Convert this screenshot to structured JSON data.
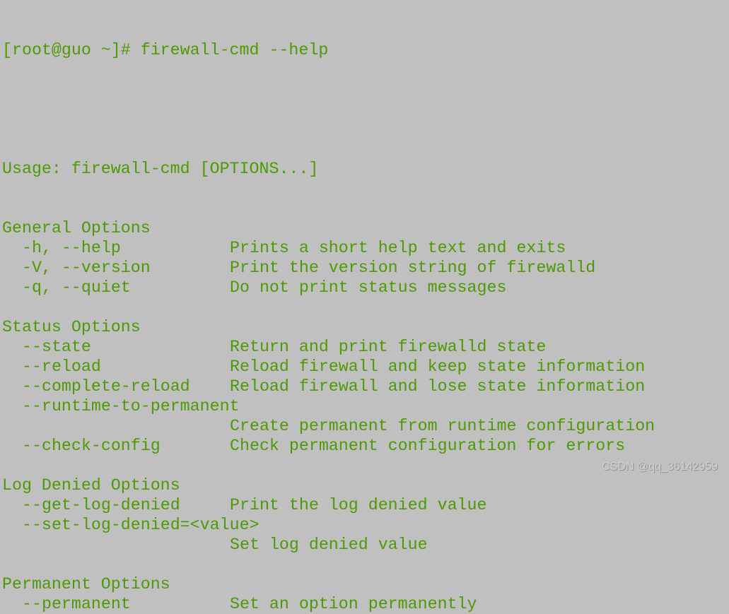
{
  "prompt": "[root@guo ~]# firewall-cmd --help",
  "usage": "Usage: firewall-cmd [OPTIONS...]",
  "sections": [
    {
      "title": "General Options",
      "options": [
        {
          "flag": "-h, --help",
          "desc": "Prints a short help text and exits"
        },
        {
          "flag": "-V, --version",
          "desc": "Print the version string of firewalld"
        },
        {
          "flag": "-q, --quiet",
          "desc": "Do not print status messages"
        }
      ]
    },
    {
      "title": "Status Options",
      "options": [
        {
          "flag": "--state",
          "desc": "Return and print firewalld state"
        },
        {
          "flag": "--reload",
          "desc": "Reload firewall and keep state information"
        },
        {
          "flag": "--complete-reload",
          "desc": "Reload firewall and lose state information"
        },
        {
          "flag": "--runtime-to-permanent",
          "desc": "Create permanent from runtime configuration",
          "wrap": true
        },
        {
          "flag": "--check-config",
          "desc": "Check permanent configuration for errors"
        }
      ]
    },
    {
      "title": "Log Denied Options",
      "options": [
        {
          "flag": "--get-log-denied",
          "desc": "Print the log denied value"
        },
        {
          "flag": "--set-log-denied=<value>",
          "desc": "Set log denied value",
          "wrap": true
        }
      ]
    },
    {
      "title": "Permanent Options",
      "options": [
        {
          "flag": "--permanent",
          "desc": "Set an option permanently"
        }
      ]
    }
  ],
  "watermark": "CSDN @qq_36142959",
  "colors": {
    "text": "#4e9a06",
    "background": "#c0c0c0"
  }
}
